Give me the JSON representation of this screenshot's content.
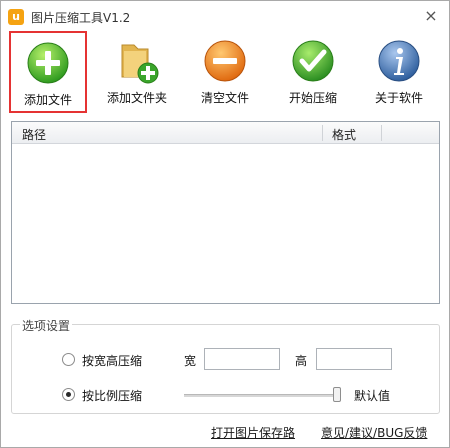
{
  "window": {
    "title": "图片压缩工具V1.2",
    "logo_letter": "u",
    "close": "×"
  },
  "toolbar": {
    "items": [
      {
        "label": "添加文件",
        "icon": "plus-circle-green"
      },
      {
        "label": "添加文件夹",
        "icon": "folder-add"
      },
      {
        "label": "清空文件",
        "icon": "minus-circle-orange"
      },
      {
        "label": "开始压缩",
        "icon": "check-circle-green"
      },
      {
        "label": "关于软件",
        "icon": "info-circle-blue"
      }
    ],
    "selected_index": 0
  },
  "file_list": {
    "columns": [
      "路径",
      "格式"
    ],
    "rows": []
  },
  "options": {
    "legend": "选项设置",
    "by_size": {
      "label": "按宽高压缩",
      "checked": false
    },
    "width_label": "宽",
    "width_value": "",
    "height_label": "高",
    "height_value": "",
    "by_ratio": {
      "label": "按比例压缩",
      "checked": true
    },
    "ratio_value_label": "默认值"
  },
  "footer": {
    "open_folder_link": "打开图片保存路",
    "feedback_link": "意见/建议/BUG反馈"
  },
  "colors": {
    "accent_green": "#3aa52b",
    "accent_orange": "#f08a1a",
    "accent_blue": "#3a6aa8",
    "selection_border": "#e53333",
    "logo_orange": "#f5a312"
  }
}
